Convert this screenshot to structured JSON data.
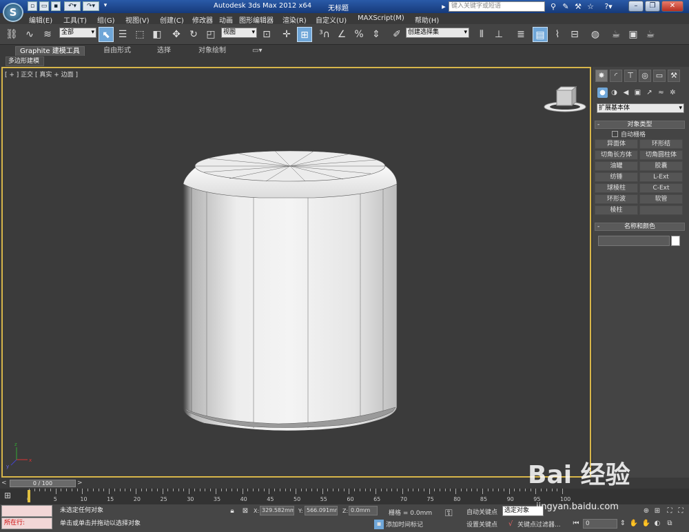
{
  "titlebar": {
    "app": "Autodesk 3ds Max  2012 x64",
    "doc": "无标题",
    "search_placeholder": "键入关键字或短语"
  },
  "menu": [
    "编辑(E)",
    "工具(T)",
    "组(G)",
    "视图(V)",
    "创建(C)",
    "修改器",
    "动画",
    "图形编辑器",
    "渲染(R)",
    "自定义(U)",
    "MAXScript(M)",
    "帮助(H)"
  ],
  "toolbar": {
    "selection_filter": "全部",
    "ref_coord": "视图",
    "named_selection": "创建选择集"
  },
  "ribbon": {
    "tabs": [
      "Graphite 建模工具",
      "自由形式",
      "选择",
      "对象绘制"
    ],
    "sub": "多边形建模"
  },
  "viewport": {
    "label": "[ + ] 正交 [ 真实 + 边面 ]"
  },
  "panel": {
    "category": "扩展基本体",
    "object_type_title": "对象类型",
    "autogrid_label": "自动栅格",
    "objects": [
      "异面体",
      "环形结",
      "切角长方体",
      "切角圆柱体",
      "油罐",
      "胶囊",
      "纺锤",
      "L-Ext",
      "球棱柱",
      "C-Ext",
      "环形波",
      "软管",
      "棱柱"
    ],
    "name_color_title": "名称和颜色"
  },
  "timeline": {
    "frame_counter": "0 / 100",
    "labels": [
      "0",
      "5",
      "10",
      "15",
      "20",
      "25",
      "30",
      "35",
      "40",
      "45",
      "50",
      "55",
      "60",
      "65",
      "70",
      "75",
      "80",
      "85",
      "90",
      "95",
      "100"
    ]
  },
  "status": {
    "maxscript_label": "所在行:",
    "selection": "未选定任何对象",
    "prompt": "单击或单击并拖动以选择对象",
    "x_label": "X:",
    "x_value": "329.582mm",
    "y_label": "Y:",
    "y_value": "566.091mm",
    "z_label": "Z:",
    "z_value": "0.0mm",
    "grid": "栅格 = 0.0mm",
    "add_time_tag": "添加时间标记",
    "auto_key": "自动关键点",
    "set_key": "设置关键点",
    "selected_dropdown": "选定对象",
    "key_filters": "关键点过滤器...",
    "frame": "0"
  },
  "watermark": {
    "text": "Bai 经验",
    "url": "jingyan.baidu.com"
  }
}
